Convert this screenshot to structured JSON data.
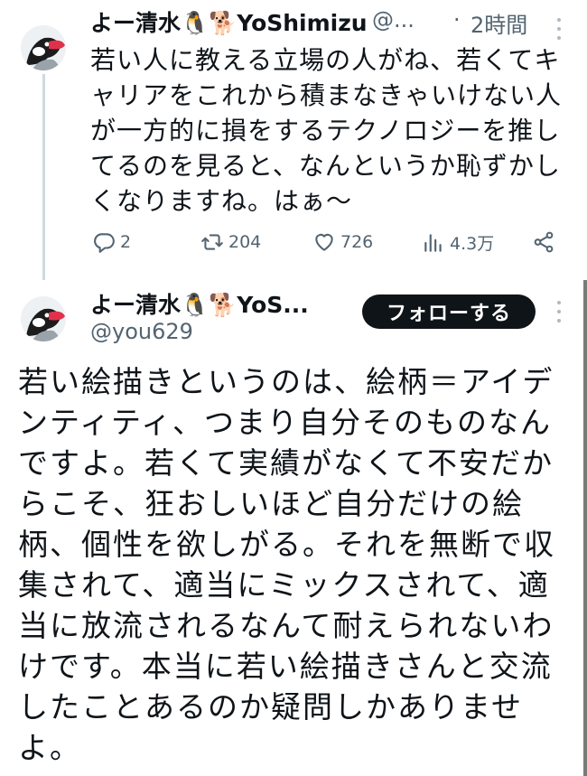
{
  "reply_tweet": {
    "display_name": "よー清水🐧🐕YoShimizu",
    "handle": "@...",
    "separator": "·",
    "time": "2時間",
    "text": "若い人に教える立場の人がね、若くてキャリアをこれから積まなきゃいけない人が一方的に損をするテクノロジーを推してるのを見ると、なんというか恥ずかしくなりますね。はぁ～",
    "stats": {
      "replies": "2",
      "retweets": "204",
      "likes": "726",
      "views": "4.3万"
    },
    "icons": {
      "reply": "reply-icon",
      "retweet": "retweet-icon",
      "like": "heart-icon",
      "views": "views-icon",
      "share": "share-icon",
      "more": "more-icon"
    }
  },
  "main_tweet": {
    "display_name": "よー清水🐧🐕YoS...",
    "handle": "@you629",
    "follow_label": "フォローする",
    "text": "若い絵描きというのは、絵柄＝アイデンティティ、つまり自分そのものなんですよ。若くて実績がなくて不安だからこそ、狂おしいほど自分だけの絵柄、個性を欲しがる。それを無断で収集されて、適当にミックスされて、適当に放流されるなんて耐えられないわけです。本当に若い絵描きさんと交流したことあるのか疑問しかありませよ。"
  },
  "colors": {
    "text": "#0f1419",
    "secondary": "#536471",
    "thread_line": "#cfd9de",
    "button_bg": "#0f1419",
    "button_text": "#ffffff"
  }
}
